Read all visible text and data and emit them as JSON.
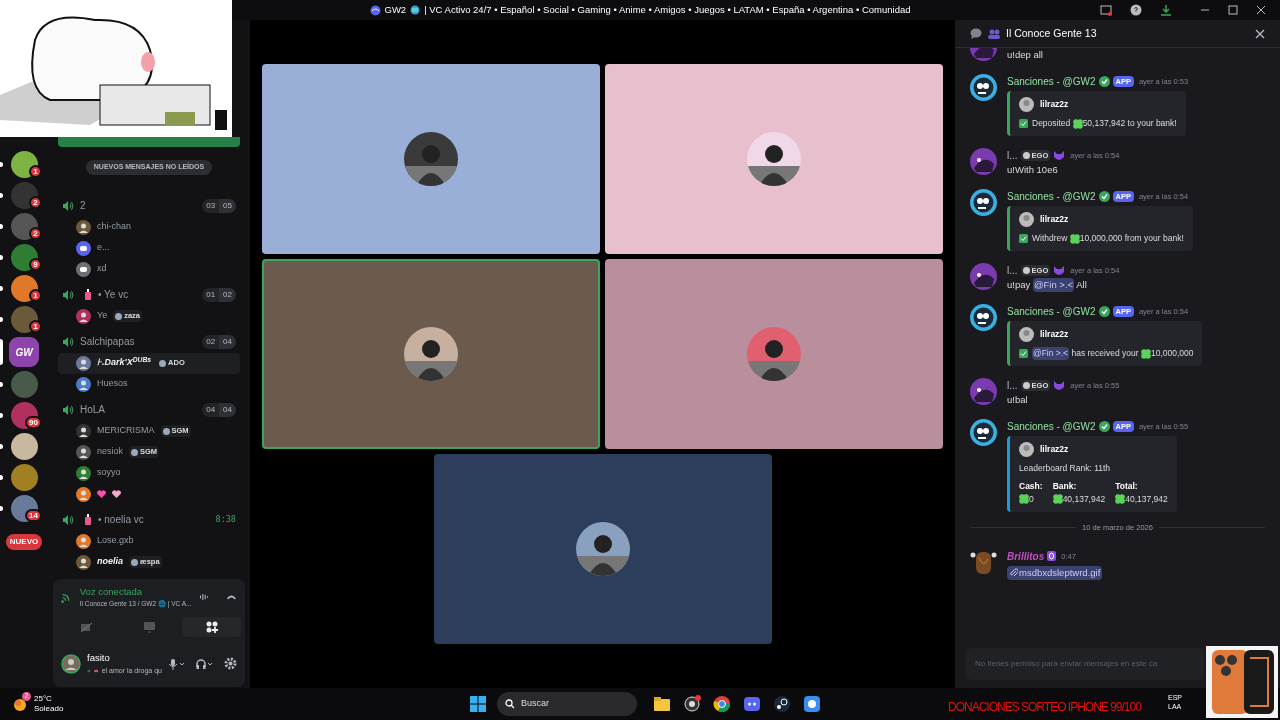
{
  "title_bar": {
    "server": "GW2",
    "title": "| VC Activo 24/7 • Español • Social • Gaming • Anime • Amigos • Juegos • LATAM • España • Argentina • Comunidad"
  },
  "servers": [
    {
      "badge": "1",
      "selected": false
    },
    {
      "badge": "2",
      "selected": false
    },
    {
      "badge": "2",
      "selected": false
    },
    {
      "badge": "9",
      "selected": false
    },
    {
      "badge": "1",
      "selected": false
    },
    {
      "badge": "1",
      "selected": false
    },
    {
      "label": "GW",
      "selected": true
    },
    {
      "selected": false
    },
    {
      "badge": "90",
      "selected": false
    },
    {
      "selected": false
    },
    {
      "selected": false
    },
    {
      "badge": "14",
      "selected": false
    }
  ],
  "new_server_pill": "NUEVO",
  "unread_pill": "NUEVOS MENSAJES NO LEÍDOS",
  "voice_channels": [
    {
      "name": "2",
      "emoji": false,
      "count_a": "03",
      "count_b": "05",
      "users": [
        {
          "kind": "name",
          "name": "chi-chan",
          "selected": false
        },
        {
          "kind": "name",
          "name": "e...",
          "color": "#5865f2",
          "selected": false
        },
        {
          "kind": "name",
          "name": "xd",
          "color": "#6d6f78",
          "selected": false
        }
      ]
    },
    {
      "name": "• Ye vc",
      "emoji": true,
      "count_a": "01",
      "count_b": "02",
      "users": [
        {
          "kind": "name",
          "name": "Ye",
          "tag": "zaza",
          "selected": false
        }
      ]
    },
    {
      "name": "Salchipapas",
      "emoji": false,
      "count_a": "02",
      "count_b": "04",
      "users": [
        {
          "kind": "name",
          "name": "⊦.Dark'X$^{DUBs}$",
          "styled": true,
          "tag": "ADO",
          "selected": true
        },
        {
          "kind": "name",
          "name": "Huesos",
          "selected": false
        }
      ]
    },
    {
      "name": "HoLA",
      "emoji": false,
      "count_a": "04",
      "count_b": "04",
      "users": [
        {
          "kind": "name",
          "name": "MERICRISMA",
          "tag": "SGM",
          "selected": false
        },
        {
          "kind": "name",
          "name": "nesiok",
          "tag": "SGM",
          "selected": false
        },
        {
          "kind": "name",
          "name": "soyyo",
          "selected": false
        },
        {
          "kind": "hearts",
          "selected": false
        }
      ]
    },
    {
      "name": "• noelia vc",
      "emoji": true,
      "timer": "8:38",
      "users": [
        {
          "kind": "name",
          "name": "Lose.gxb",
          "selected": false
        },
        {
          "kind": "name",
          "name": "noelia",
          "styled": true,
          "tag": "æspa",
          "selected": false
        }
      ]
    }
  ],
  "voice_panel": {
    "status": "Voz conectada",
    "channel": "Il Conoce Gente 13 / GW2 🌐 | VC A...",
    "user": "fasito",
    "custom_status": "el amor la droga qu"
  },
  "video_tiles": [
    {
      "color": "#9aafd8",
      "speaking": false
    },
    {
      "color": "#e8bfcc",
      "speaking": false
    },
    {
      "color": "#6b5b4f",
      "speaking": true
    },
    {
      "color": "#b98f9d",
      "speaking": false
    },
    {
      "color": "#2c3e5c",
      "speaking": false
    }
  ],
  "chat": {
    "title": "Il Conoce Gente 13",
    "messages": [
      {
        "kind": "user",
        "text": "u!dep all"
      },
      {
        "kind": "bot",
        "author": "Sanciones - @GW2",
        "badge": "APP",
        "time": "ayer a las 0:53",
        "embed": {
          "color": "#3ba55d",
          "author": "lilraz2z",
          "lines": [
            [
              {
                "kind": "text",
                "text": "Deposited "
              },
              {
                "kind": "coin",
                "text": "50,137,942"
              },
              {
                "kind": "text",
                "text": " to your bank!"
              }
            ]
          ]
        }
      },
      {
        "kind": "user",
        "author": "l...",
        "tag": "EGO",
        "time": "ayer a las 0:54",
        "text": "u!With 10e6"
      },
      {
        "kind": "bot",
        "author": "Sanciones - @GW2",
        "badge": "APP",
        "time": "ayer a las 0:54",
        "embed": {
          "color": "#3ba55d",
          "author": "lilraz2z",
          "lines": [
            [
              {
                "kind": "text",
                "text": "Withdrew "
              },
              {
                "kind": "coin",
                "text": "10,000,000"
              },
              {
                "kind": "text",
                "text": " from your bank!"
              }
            ]
          ]
        }
      },
      {
        "kind": "user",
        "author": "l...",
        "tag": "EGO",
        "time": "ayer a las 0:54",
        "parts": [
          {
            "kind": "text",
            "text": "u!pay "
          },
          {
            "kind": "mention",
            "text": "@Fin >.<"
          },
          {
            "kind": "text",
            "text": " All"
          }
        ]
      },
      {
        "kind": "bot",
        "author": "Sanciones - @GW2",
        "badge": "APP",
        "time": "ayer a las 0:54",
        "embed": {
          "color": "#3ba55d",
          "author": "lilraz2z",
          "lines": [
            [
              {
                "kind": "mention",
                "text": "@Fin >.<"
              },
              {
                "kind": "text",
                "text": " has received your "
              },
              {
                "kind": "coin",
                "text": "10,000,000"
              }
            ]
          ]
        }
      },
      {
        "kind": "user",
        "author": "l...",
        "tag": "EGO",
        "time": "ayer a las 0:55",
        "text": "u!bal"
      },
      {
        "kind": "bot",
        "author": "Sanciones - @GW2",
        "badge": "APP",
        "time": "ayer a las 0:55",
        "embed": {
          "color": "#1e9bd7",
          "author": "lilraz2z",
          "plain": "Leaderboard Rank: 11th",
          "fields": [
            {
              "name": "Cash:",
              "value": "0"
            },
            {
              "name": "Bank:",
              "value": "40,137,942"
            },
            {
              "name": "Total:",
              "value": "40,137,942"
            }
          ]
        }
      },
      {
        "kind": "divider",
        "text": "10 de marzo de 2026"
      },
      {
        "kind": "user",
        "author": "Brillitos",
        "color": "#c24fc2",
        "time": "0:47",
        "attachment": "msdbxdsleptwrd.gif"
      }
    ],
    "input_placeholder": "No tienes permiso para enviar mensajes en este ca"
  },
  "taskbar": {
    "temperature": "25°C",
    "weather": "Soleado",
    "weather_badge": "2",
    "search": {
      "placeholder": "Buscar"
    },
    "language": "ESP",
    "layout": "LAA"
  },
  "overlay_text": "DONACIONES SORTEO IPHONE 99/100"
}
